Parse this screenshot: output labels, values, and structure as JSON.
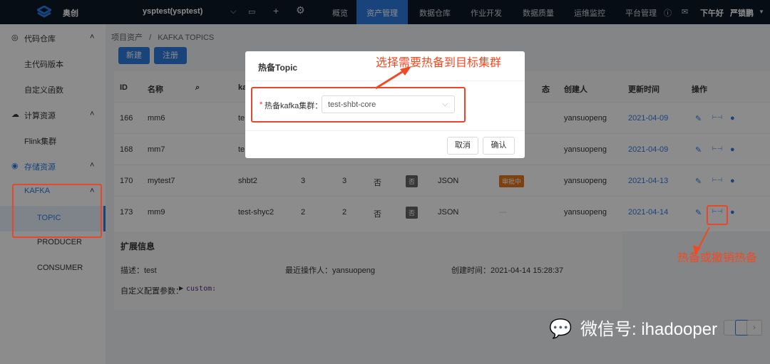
{
  "topnav": {
    "brand": "奥创",
    "project": "ysptest(ysptest)",
    "items": [
      "概览",
      "资产管理",
      "数据仓库",
      "作业开发",
      "数据质量",
      "运维监控",
      "平台管理"
    ],
    "active": "资产管理",
    "greeting": "下午好",
    "user": "严锁鹏"
  },
  "sidebar": {
    "groups": [
      {
        "label": "代码仓库",
        "icon": "code-icon",
        "items": [
          "主代码版本",
          "自定义函数"
        ]
      },
      {
        "label": "计算资源",
        "icon": "cloud-icon",
        "items": [
          "Flink集群"
        ]
      },
      {
        "label": "存储资源",
        "icon": "database-icon",
        "sub": {
          "label": "KAFKA",
          "items": [
            "TOPIC",
            "PRODUCER",
            "CONSUMER"
          ],
          "active": "TOPIC"
        }
      }
    ]
  },
  "breadcrumb": [
    "项目资产",
    "/",
    "KAFKA TOPICS"
  ],
  "toolbar": {
    "new": "新建",
    "register": "注册"
  },
  "table": {
    "headers": {
      "id": "ID",
      "name": "名称",
      "cluster": "ka",
      "status": "态",
      "creator": "创建人",
      "updated": "更新时间",
      "ops": "操作"
    },
    "rows": [
      {
        "id": "166",
        "name": "mm6",
        "cluster": "te",
        "part": "",
        "rep": "",
        "flag": "",
        "badge": "",
        "format": "",
        "status": "",
        "creator": "yansuopeng",
        "updated": "2021-04-09"
      },
      {
        "id": "168",
        "name": "mm7",
        "cluster": "te",
        "part": "",
        "rep": "",
        "flag": "",
        "badge": "",
        "format": "",
        "status": "",
        "creator": "yansuopeng",
        "updated": "2021-04-09"
      },
      {
        "id": "170",
        "name": "mytest7",
        "cluster": "shbt2",
        "part": "3",
        "rep": "3",
        "flag": "否",
        "badge": "否",
        "format": "JSON",
        "status": "审批中",
        "creator": "yansuopeng",
        "updated": "2021-04-13"
      },
      {
        "id": "173",
        "name": "mm9",
        "cluster": "test-shyc2",
        "part": "2",
        "rep": "2",
        "flag": "否",
        "badge": "否",
        "format": "JSON",
        "status": "—",
        "creator": "yansuopeng",
        "updated": "2021-04-14"
      }
    ]
  },
  "ext": {
    "title": "扩展信息",
    "desc": "描述：test",
    "operator": "最近操作人：yansuopeng",
    "created": "创建时间：2021-04-14 15:28:37",
    "config_label": "自定义配置参数：",
    "config_value": "custom:"
  },
  "modal": {
    "title": "热备Topic",
    "field_label": "热备kafka集群：",
    "field_value": "test-shbt-core",
    "cancel": "取消",
    "ok": "确认"
  },
  "annotations": {
    "top": "选择需要热备到目标集群",
    "right": "热备或撤销热备",
    "color": "#f04a24"
  },
  "watermark": "微信号: ihadooper",
  "pagination": {
    "next": "›"
  }
}
